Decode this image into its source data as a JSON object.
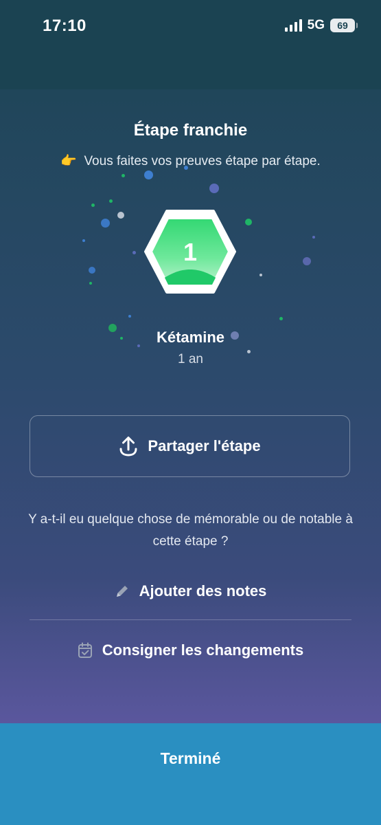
{
  "status_bar": {
    "time": "17:10",
    "network": "5G",
    "battery": "69"
  },
  "header": {
    "title": "Étape franchie",
    "subtitle_emoji": "👉",
    "subtitle": "Vous faites vos preuves étape par étape."
  },
  "milestone": {
    "number": "1",
    "substance": "Kétamine",
    "duration": "1 an"
  },
  "share": {
    "label": "Partager l'étape"
  },
  "prompt": {
    "question": "Y a-t-il eu quelque chose de mémorable ou de notable à cette étape ?"
  },
  "actions": [
    {
      "label": "Ajouter des notes",
      "icon": "pencil-icon"
    },
    {
      "label": "Consigner les changements",
      "icon": "calendar-check-icon"
    }
  ],
  "footer": {
    "done_label": "Terminé"
  },
  "colors": {
    "badge_green": "#2fd36e",
    "footer_blue": "#2a8fc1",
    "header_bg": "#1b4352"
  }
}
